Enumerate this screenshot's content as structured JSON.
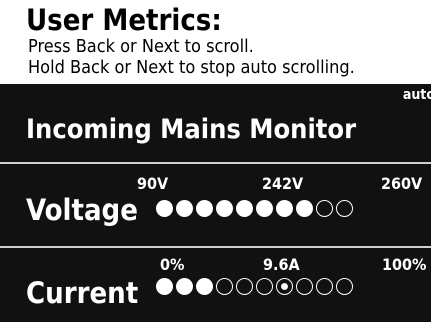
{
  "header": {
    "title": "User Metrics:",
    "line1": "Press Back or Next to scroll.",
    "line2": "Hold Back or Next to stop auto scrolling."
  },
  "status": {
    "auto": "auto"
  },
  "monitor": {
    "title": "Incoming Mains Monitor"
  },
  "voltage": {
    "label": "Voltage",
    "scale": {
      "min": "90V",
      "value": "242V",
      "max": "260V"
    },
    "dots": [
      "filled",
      "filled",
      "filled",
      "filled",
      "filled",
      "filled",
      "filled",
      "filled",
      "empty",
      "empty"
    ]
  },
  "current": {
    "label": "Current",
    "scale": {
      "min": "0%",
      "value": "9.6A",
      "max": "100%"
    },
    "dots": [
      "filled",
      "filled",
      "filled",
      "empty",
      "empty",
      "empty",
      "marker",
      "empty",
      "empty",
      "empty"
    ]
  },
  "colors": {
    "background": "#111111",
    "foreground": "#ffffff",
    "header_background": "#ffffff",
    "header_text": "#000000",
    "divider": "#cfcfcf"
  }
}
